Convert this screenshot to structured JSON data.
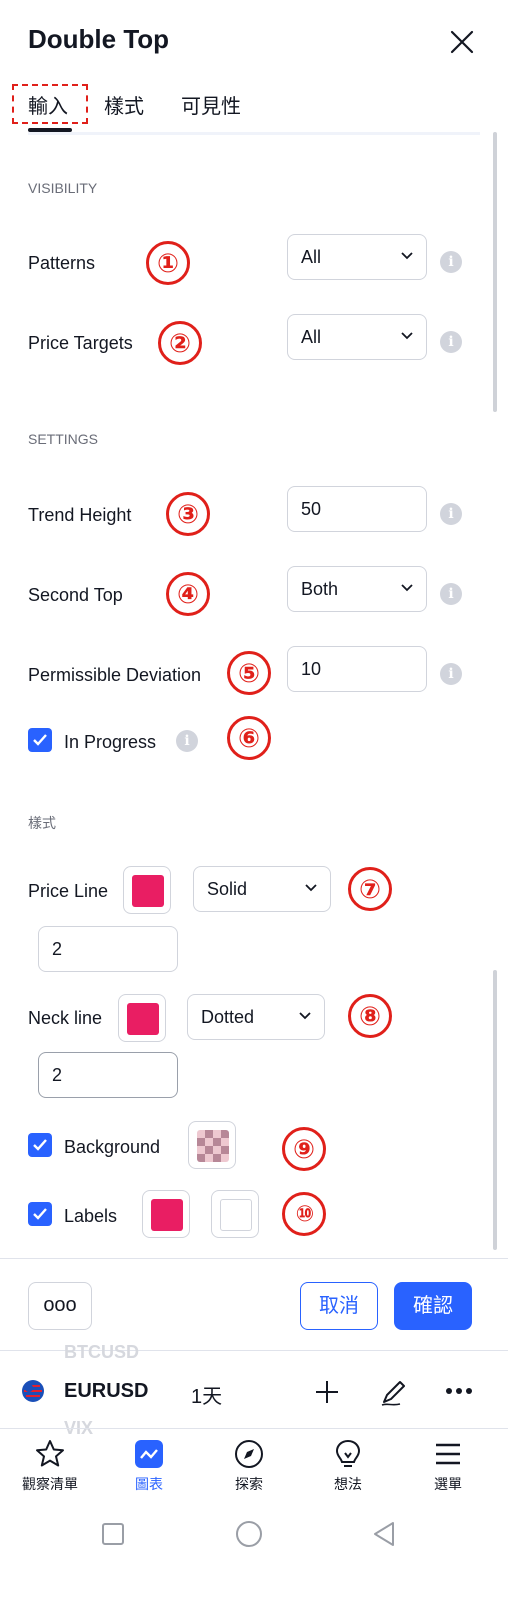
{
  "dialog": {
    "title": "Double Top",
    "tabs": [
      "輸入",
      "樣式",
      "可見性"
    ]
  },
  "sections": {
    "visibility": "VISIBILITY",
    "settings": "SETTINGS",
    "style": "樣式"
  },
  "fields": {
    "patterns": {
      "label": "Patterns",
      "value": "All"
    },
    "price_targets": {
      "label": "Price Targets",
      "value": "All"
    },
    "trend_height": {
      "label": "Trend Height",
      "value": "50"
    },
    "second_top": {
      "label": "Second Top",
      "value": "Both"
    },
    "permissible_deviation": {
      "label": "Permissible Deviation",
      "value": "10"
    },
    "in_progress": {
      "label": "In Progress",
      "checked": true
    },
    "price_line": {
      "label": "Price Line",
      "color": "#e91e63",
      "style": "Solid",
      "width": "2"
    },
    "neck_line": {
      "label": "Neck line",
      "color": "#e91e63",
      "style": "Dotted",
      "width": "2"
    },
    "background": {
      "label": "Background",
      "checked": true
    },
    "labels": {
      "label": "Labels",
      "checked": true,
      "color": "#e91e63",
      "text_color": "#ffffff"
    }
  },
  "annotations": [
    "①",
    "②",
    "③",
    "④",
    "⑤",
    "⑥",
    "⑦",
    "⑧",
    "⑨",
    "⑩"
  ],
  "footer": {
    "more": "ooo",
    "cancel": "取消",
    "confirm": "確認"
  },
  "toolbar": {
    "ghost_top": "BTCUSD",
    "symbol": "EURUSD",
    "interval": "1天",
    "ghost_bottom": "VIX"
  },
  "bottom_nav": {
    "items": [
      "觀察清單",
      "圖表",
      "探索",
      "想法",
      "選單"
    ],
    "active_index": 1
  },
  "colors": {
    "accent": "#2962ff",
    "annotation": "#e0201a",
    "swatch": "#e91e63"
  }
}
